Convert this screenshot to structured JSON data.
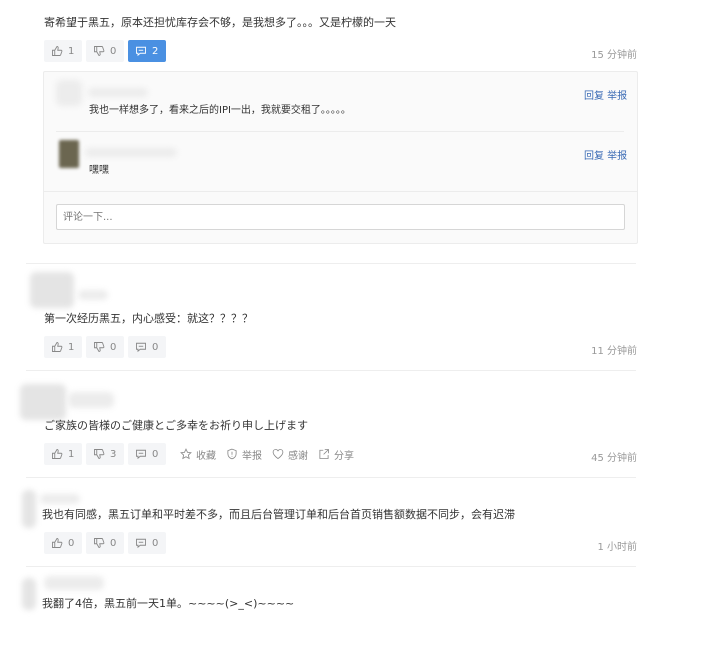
{
  "comments": [
    {
      "text": "寄希望于黑五，原本还担忧库存会不够，是我想多了。。。又是柠檬的一天",
      "like": "1",
      "dislike": "0",
      "reply_count": "2",
      "time": "15 分钟前",
      "replies": [
        {
          "text": "我也一样想多了，看来之后的IPI一出，我就要交租了。。。。。",
          "links": "回复 举报"
        },
        {
          "text": "嘿嘿",
          "links": "回复 举报"
        }
      ],
      "input_placeholder": "评论一下..."
    },
    {
      "text": "第一次经历黑五，内心感受：就这？？？？",
      "like": "1",
      "dislike": "0",
      "reply_count": "0",
      "time": "11 分钟前"
    },
    {
      "text": "ご家族の皆様のご健康とご多幸をお祈り申し上げます",
      "like": "1",
      "dislike": "3",
      "reply_count": "0",
      "extras": {
        "collect": "收藏",
        "report": "举报",
        "thanks": "感谢",
        "share": "分享"
      },
      "time": "45 分钟前"
    },
    {
      "text": "我也有同感，黑五订单和平时差不多，而且后台管理订单和后台首页销售额数据不同步，会有迟滞",
      "like": "0",
      "dislike": "0",
      "reply_count": "0",
      "time": "1 小时前"
    },
    {
      "text": "我翻了4倍，黑五前一天1单。~~~~(>_<)~~~~"
    }
  ],
  "colors": {
    "accent": "#4a90e2",
    "link": "#3b6bb5"
  }
}
